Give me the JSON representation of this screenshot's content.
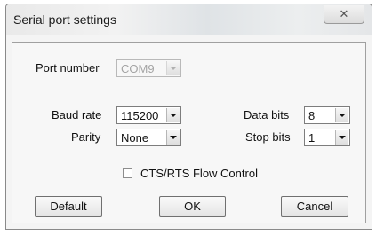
{
  "dialog": {
    "title": "Serial port settings",
    "close_glyph": "✕"
  },
  "fields": {
    "port_number": {
      "label": "Port number",
      "value": "COM9",
      "enabled": false
    },
    "baud_rate": {
      "label": "Baud rate",
      "value": "115200"
    },
    "parity": {
      "label": "Parity",
      "value": "None"
    },
    "data_bits": {
      "label": "Data bits",
      "value": "8"
    },
    "stop_bits": {
      "label": "Stop bits",
      "value": "1"
    }
  },
  "flow_control": {
    "label": "CTS/RTS Flow Control",
    "checked": false
  },
  "buttons": {
    "default": "Default",
    "ok": "OK",
    "cancel": "Cancel"
  }
}
